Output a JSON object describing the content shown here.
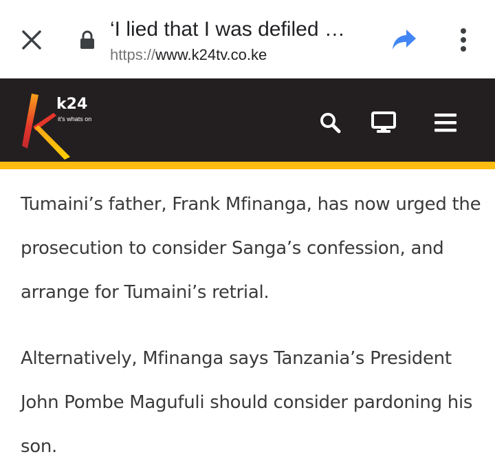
{
  "browser": {
    "page_title": "‘I lied that I was defiled …",
    "url_scheme": "https://",
    "url_host": "www.k24tv.co.ke"
  },
  "site": {
    "logo_text": "k24",
    "tagline": "it's whats on",
    "colors": {
      "header_bg": "#231f20",
      "accent": "#fdbd10"
    }
  },
  "icons": {
    "close": "close-icon",
    "lock": "lock-icon",
    "share": "share-icon",
    "menu": "more-vert-icon",
    "search": "search-icon",
    "tv": "tv-icon",
    "hamburger": "hamburger-icon"
  },
  "article": {
    "paragraphs": [
      "Tumaini’s father, Frank Mfinanga, has now urged the prosecution to consider Sanga’s confession, and arrange for Tumaini’s retrial.",
      "Alternatively, Mfinanga says Tanzania’s President John Pombe Magufuli should consider pardoning his son."
    ]
  }
}
